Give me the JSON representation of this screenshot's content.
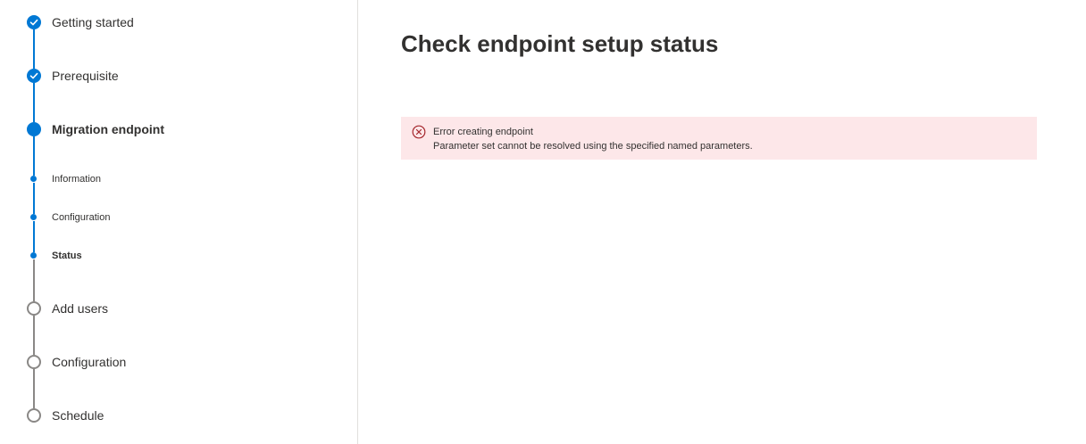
{
  "wizard": {
    "steps": [
      {
        "label": "Getting started",
        "state": "completed"
      },
      {
        "label": "Prerequisite",
        "state": "completed"
      },
      {
        "label": "Migration endpoint",
        "state": "current"
      },
      {
        "label": "Add users",
        "state": "pending"
      },
      {
        "label": "Configuration",
        "state": "pending"
      },
      {
        "label": "Schedule",
        "state": "pending"
      }
    ],
    "substeps": [
      {
        "label": "Information",
        "state": "completed"
      },
      {
        "label": "Configuration",
        "state": "completed"
      },
      {
        "label": "Status",
        "state": "current"
      }
    ]
  },
  "main": {
    "title": "Check endpoint setup status",
    "error": {
      "title": "Error creating endpoint",
      "message": "Parameter set cannot be resolved using the specified named parameters."
    }
  },
  "colors": {
    "accent": "#0078d4",
    "error_background": "#fde7e9",
    "error_icon": "#a4262c",
    "pending": "#8a8886"
  },
  "icons": {
    "completed": "checkmark-icon",
    "error": "error-circle-icon"
  }
}
